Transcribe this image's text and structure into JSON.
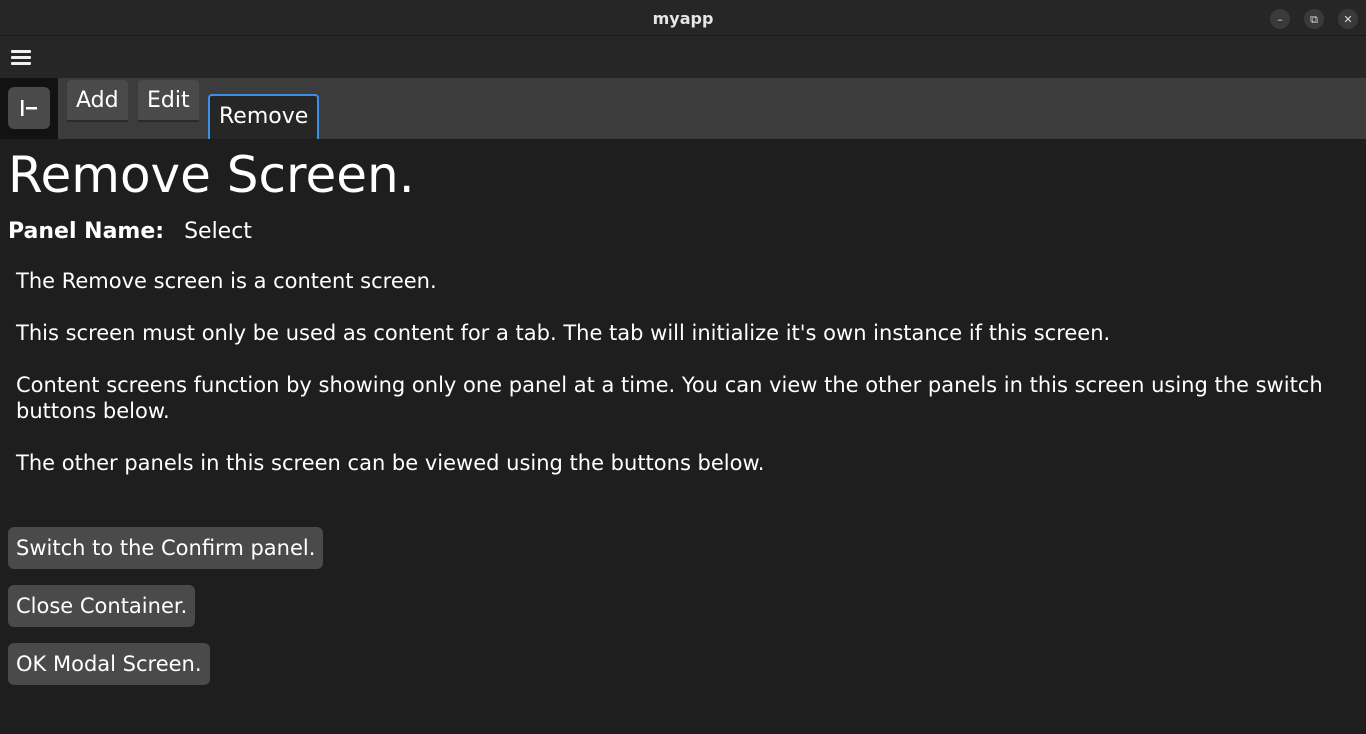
{
  "window": {
    "title": "myapp",
    "minimize_icon": "–",
    "maximize_icon": "⧉",
    "close_icon": "✕"
  },
  "tabs": [
    {
      "label": "Add",
      "active": false
    },
    {
      "label": "Edit",
      "active": false
    },
    {
      "label": "Remove",
      "active": true
    }
  ],
  "content": {
    "heading": "Remove Screen.",
    "panel_name_label": "Panel Name:",
    "panel_name_value": "Select",
    "paragraphs": [
      "The Remove screen is a content screen.",
      "This screen must only be used as content for a tab. The tab will initialize it's own instance if this screen.",
      "Content screens function by showing only one panel at a time. You can view the other panels in this screen using the switch buttons below.",
      "The other panels in this screen can be viewed using the buttons below."
    ],
    "buttons": [
      "Switch to the Confirm panel.",
      "Close Container.",
      "OK Modal Screen."
    ]
  },
  "colors": {
    "background": "#1e1e1e",
    "bar": "#262626",
    "tab_bar": "#3c3c3c",
    "button": "#4a4a4a",
    "active_tab_border": "#3d8fe6"
  },
  "icons": {
    "menu": "hamburger-icon",
    "collapse": "collapse-left-icon"
  }
}
